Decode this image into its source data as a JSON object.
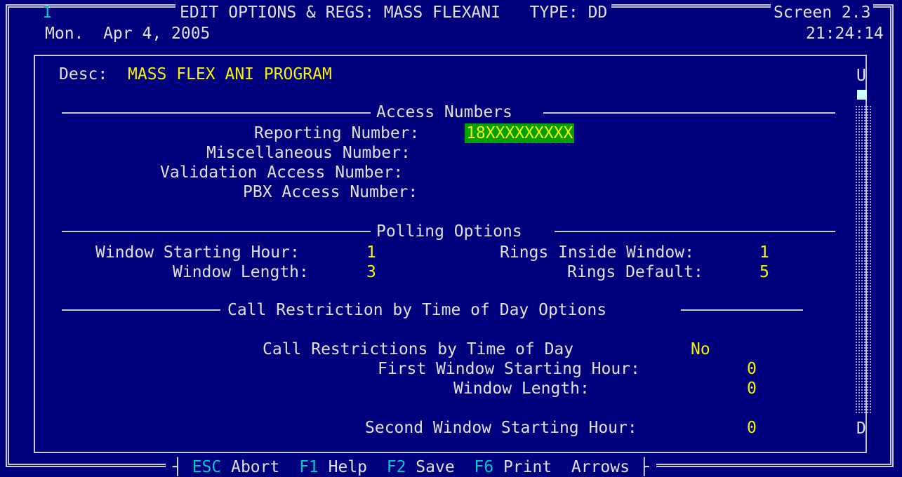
{
  "header": {
    "window_number": "1",
    "title": "EDIT OPTIONS & REGS: MASS FLEXANI   TYPE: DD",
    "screen": "Screen 2.3",
    "date": "Mon.  Apr 4, 2005",
    "time": "21:24:14"
  },
  "scroll": {
    "up": "U",
    "down": "D"
  },
  "desc": {
    "label": "Desc:",
    "value": "MASS FLEX ANI PROGRAM"
  },
  "access": {
    "title": "Access Numbers",
    "reporting_label": "Reporting Number:",
    "reporting_value": "18XXXXXXXXX",
    "misc_label": "Miscellaneous Number:",
    "validation_label": "Validation Access Number:",
    "pbx_label": "PBX Access Number:"
  },
  "polling": {
    "title": "Polling Options",
    "start_label": "Window Starting Hour:",
    "start_value": "1",
    "length_label": "Window Length:",
    "length_value": "3",
    "rings_inside_label": "Rings Inside Window:",
    "rings_inside_value": "1",
    "rings_default_label": "Rings Default:",
    "rings_default_value": "5"
  },
  "restriction": {
    "title": "Call Restriction by Time of Day Options",
    "enabled_label": "Call Restrictions by Time of Day",
    "enabled_value": "No",
    "first_start_label": "First Window Starting Hour:",
    "first_start_value": "0",
    "window_length_label": "Window Length:",
    "window_length_value": "0",
    "second_start_label": "Second Window Starting Hour:",
    "second_start_value": "0"
  },
  "footer": {
    "esc_key": "ESC",
    "esc_label": "Abort",
    "f1_key": "F1",
    "f1_label": "Help",
    "f2_key": "F2",
    "f2_label": "Save",
    "f6_key": "F6",
    "f6_label": "Print",
    "arrows_label": "Arrows"
  },
  "colors": {
    "background": "#00007E",
    "text": "#E0E0E0",
    "value": "#F4F400",
    "key": "#00C8C8",
    "highlight": "#00A000"
  }
}
